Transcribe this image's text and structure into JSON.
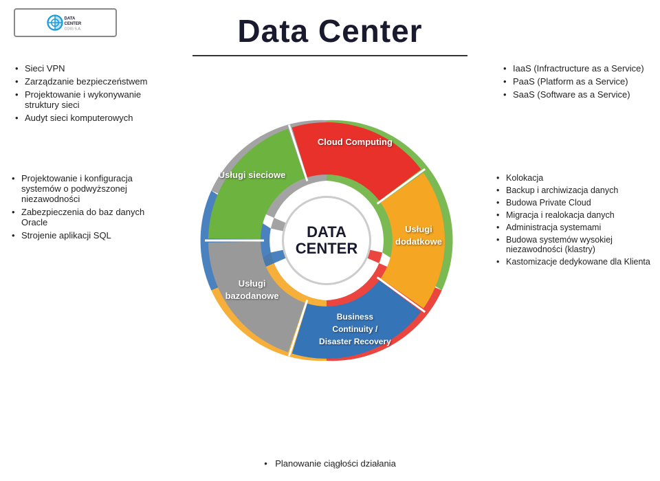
{
  "title": "Data Center",
  "logo": {
    "line1": "DATA CENTER",
    "line2": "COIG S.A."
  },
  "left_top": {
    "items": [
      "Sieci VPN",
      "Zarządzanie bezpieczeństwem",
      "Projektowanie i wykonywanie struktury sieci",
      "Audyt sieci komputerowych"
    ]
  },
  "right_top": {
    "items": [
      "IaaS (Infractructure as a Service)",
      "PaaS (Platform as a Service)",
      "SaaS (Software as a Service)"
    ]
  },
  "left_mid": {
    "items": [
      "Projektowanie i konfiguracja systemów o podwyższonej niezawodności",
      "Zabezpieczenia do baz danych Oracle",
      "Strojenie aplikacji SQL"
    ]
  },
  "right_mid": {
    "items": [
      "Kolokacja",
      "Backup i archiwizacja danych",
      "Budowa Private Cloud",
      "Migracja i realokacja danych",
      "Administracja systemami",
      "Budowa systemów wysokiej niezawodności (klastry)",
      "Kastomizacje dedykowane dla Klienta"
    ]
  },
  "bottom": {
    "items": [
      "Planowanie ciągłości działania"
    ]
  },
  "donut": {
    "center_line1": "DATA",
    "center_line2": "CENTER",
    "segments": [
      {
        "label": "Usługi\nsieciowe",
        "color": "#6db33f"
      },
      {
        "label": "Cloud\nComputing",
        "color": "#e8312a"
      },
      {
        "label": "Usługi\ndodatkowe",
        "color": "#f5a623"
      },
      {
        "label": "Business Continuity /\nDisaster Recovery",
        "color": "#3b5998"
      },
      {
        "label": "Usługi\nbazodanowe",
        "color": "#888888"
      }
    ]
  }
}
